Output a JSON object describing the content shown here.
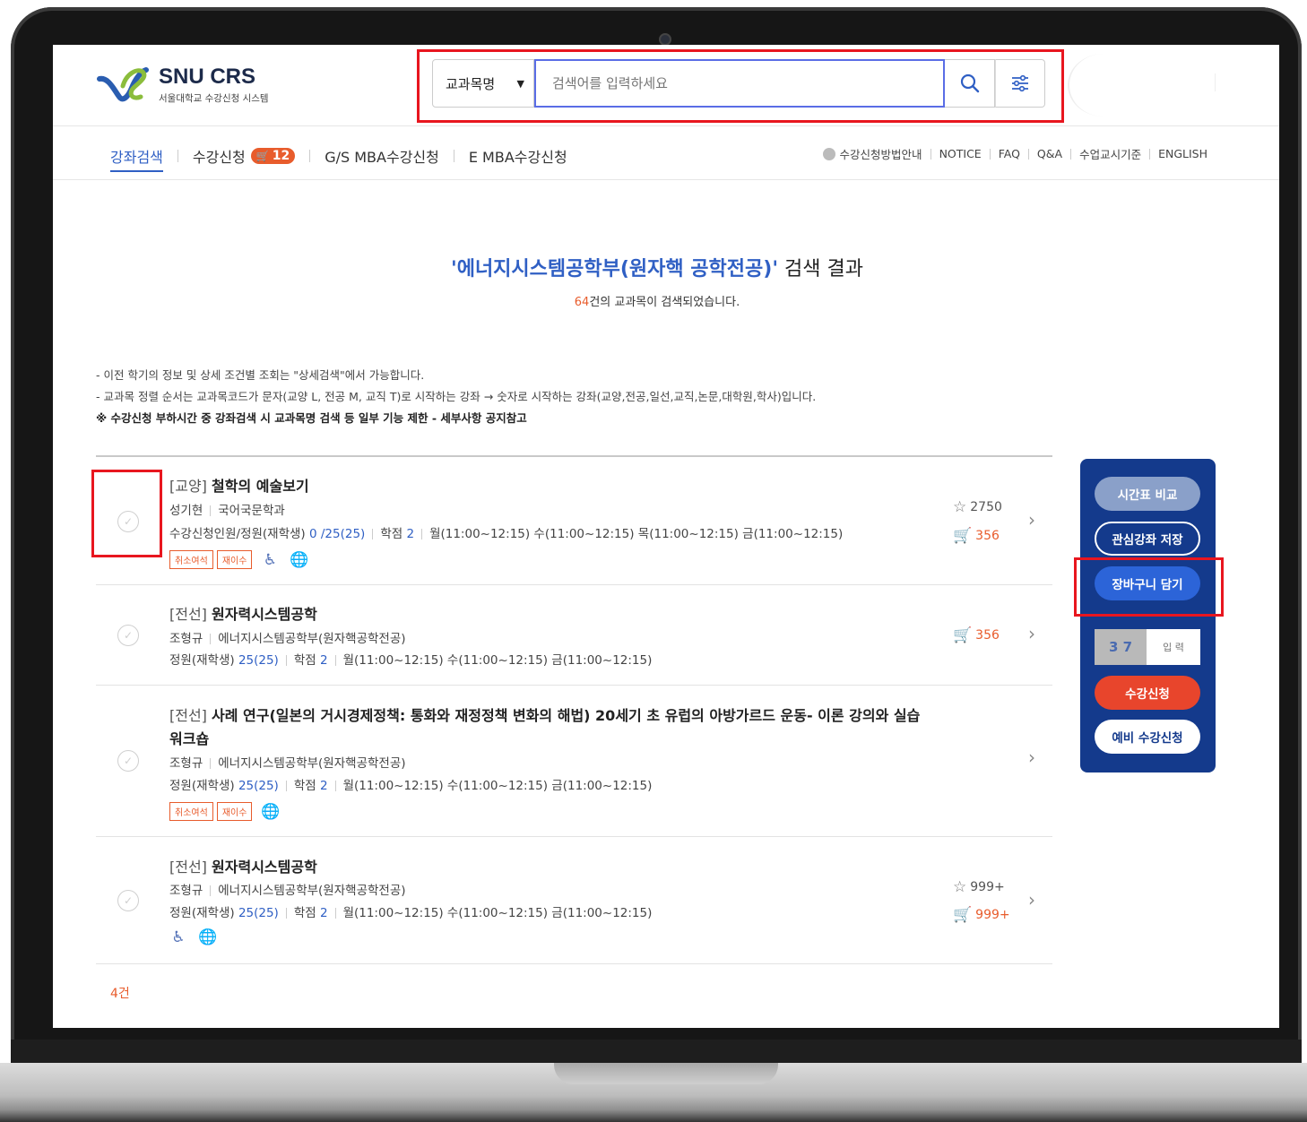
{
  "logo": {
    "title": "SNU CRS",
    "subtitle": "서울대학교 수강신청 시스템"
  },
  "search": {
    "select_value": "교과목명",
    "placeholder": "검색어를 입력하세요",
    "search_icon": "search-icon",
    "filter_icon": "sliders-icon"
  },
  "nav": {
    "items": [
      {
        "label": "강좌검색",
        "active": true
      },
      {
        "label": "수강신청",
        "badge": "12"
      },
      {
        "label": "G/S MBA수강신청"
      },
      {
        "label": "E MBA수강신청"
      }
    ],
    "right_links": [
      "수강신청방법안내",
      "NOTICE",
      "FAQ",
      "Q&A",
      "수업교시기준",
      "ENGLISH"
    ]
  },
  "results": {
    "query": "'에너지시스템공학부(원자핵 공학전공)'",
    "suffix": " 검색 결과",
    "count": "64",
    "count_text": "건의 교과목이 검색되었습니다."
  },
  "notes": [
    "- 이전 학기의 정보 및 상세 조건별 조회는 \"상세검색\"에서 가능합니다.",
    "- 교과목 정렬 순서는 교과목코드가 문자(교양 L, 전공 M, 교직 T)로 시작하는 강좌 → 숫자로 시작하는 강좌(교양,전공,일선,교직,논문,대학원,학사)입니다.",
    "※ 수강신청 부하시간 중 강좌검색 시 교과목명 검색 등 일부 기능 제한 - 세부사항 공지참고"
  ],
  "courses": [
    {
      "category": "[교양]",
      "name": "철학의 예술보기",
      "professor": "성기현",
      "dept": "국어국문학과",
      "cap_label": "수강신청인원/정원(재학생)",
      "cap_value": "0 /25(25)",
      "credit_label": "학점",
      "credit": "2",
      "schedule": "월(11:00~12:15) 수(11:00~12:15) 목(11:00~12:15) 금(11:00~12:15)",
      "tags": [
        "취소여석",
        "재이수"
      ],
      "stars": "2750",
      "cart": "356"
    },
    {
      "category": "[전선]",
      "name": "원자력시스템공학",
      "professor": "조형규",
      "dept": "에너지시스템공학부(원자핵공학전공)",
      "cap_label": "정원(재학생)",
      "cap_value": "25(25)",
      "credit_label": "학점",
      "credit": "2",
      "schedule": "월(11:00~12:15) 수(11:00~12:15) 금(11:00~12:15)",
      "cart": "356"
    },
    {
      "category": "[전선]",
      "name": "사례 연구(일본의 거시경제정책: 통화와 재정정책 변화의 해법) 20세기 초 유럽의 아방가르드 운동- 이론 강의와 실습",
      "name_line2": "워크숍",
      "professor": "조형규",
      "dept": "에너지시스템공학부(원자핵공학전공)",
      "cap_label": "정원(재학생)",
      "cap_value": "25(25)",
      "credit_label": "학점",
      "credit": "2",
      "schedule": "월(11:00~12:15) 수(11:00~12:15) 금(11:00~12:15)",
      "tags": [
        "취소여석",
        "재이수"
      ]
    },
    {
      "category": "[전선]",
      "name": "원자력시스템공학",
      "professor": "조형규",
      "dept": "에너지시스템공학부(원자핵공학전공)",
      "cap_label": "정원(재학생)",
      "cap_value": "25(25)",
      "credit_label": "학점",
      "credit": "2",
      "schedule": "월(11:00~12:15) 수(11:00~12:15) 금(11:00~12:15)",
      "stars": "999+",
      "cart": "999+"
    }
  ],
  "footer_count": "4건",
  "side_panel": {
    "compare": "시간표 비교",
    "save": "관심강좌 저장",
    "cart": "장바구니 담기",
    "captcha": "3 7",
    "captcha_placeholder": "입 력",
    "apply": "수강신청",
    "pre_apply": "예비 수강신청"
  },
  "colors": {
    "primary": "#2f5fc4",
    "panel": "#143a8c",
    "accent": "#e85c2c",
    "highlight": "#e8161f"
  }
}
